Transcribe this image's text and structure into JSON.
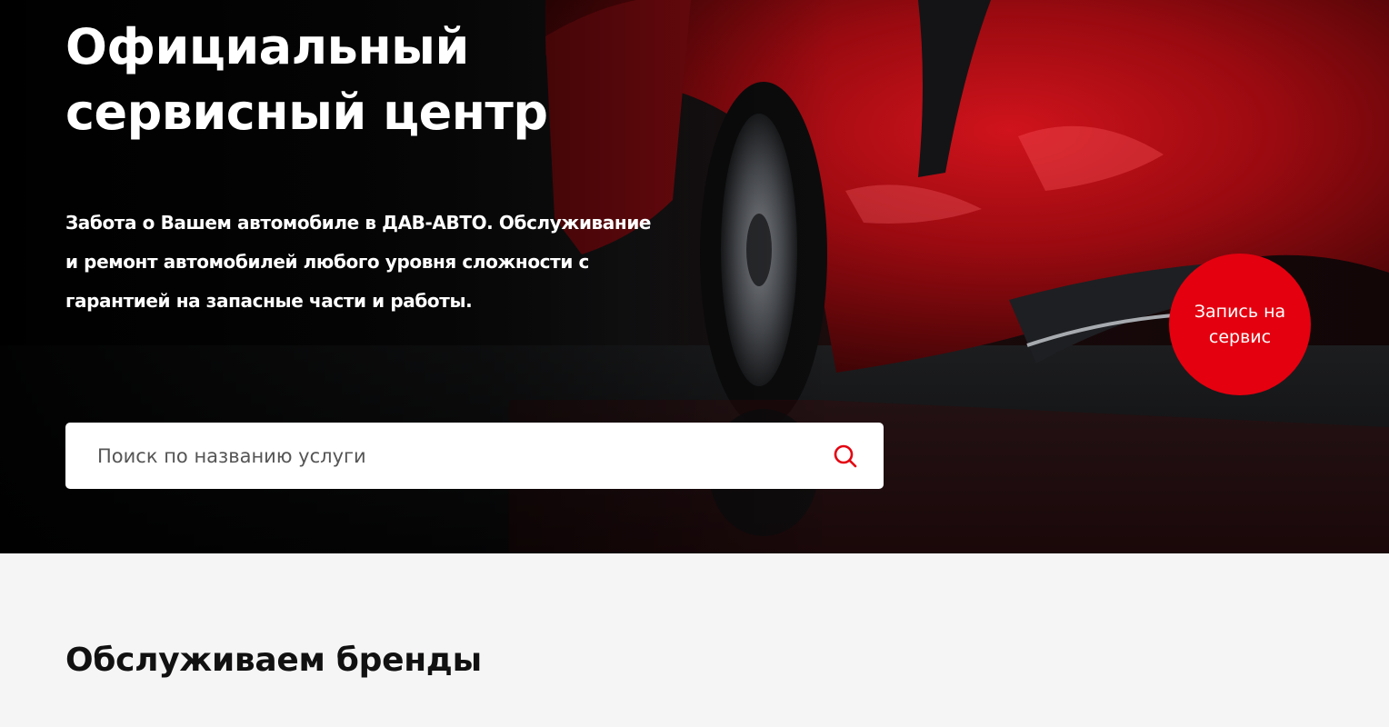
{
  "hero": {
    "title_line1": "Официальный",
    "title_line2": "сервисный центр",
    "description": "Забота о Вашем автомобиле в ДАВ-АВТО. Обслуживание и ремонт автомобилей любого уровня сложности с гарантией на запасные части и работы."
  },
  "search": {
    "placeholder": "Поиск по названию услуги",
    "icon": "search-icon",
    "icon_color": "#e4000f"
  },
  "cta": {
    "label": "Запись на сервис",
    "color": "#e4000f"
  },
  "brands": {
    "title": "Обслуживаем бренды"
  }
}
